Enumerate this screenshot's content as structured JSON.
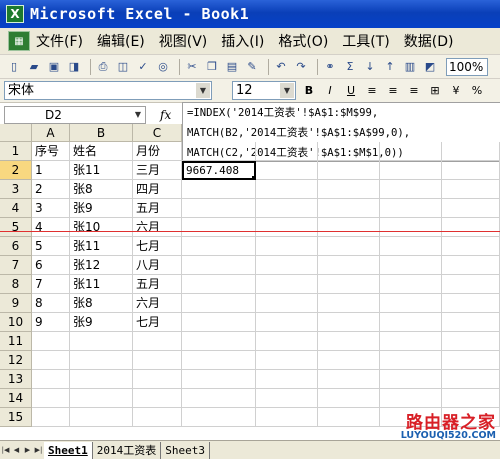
{
  "window": {
    "title": "Microsoft Excel - Book1"
  },
  "menu": {
    "items": [
      "文件(F)",
      "编辑(E)",
      "视图(V)",
      "插入(I)",
      "格式(O)",
      "工具(T)",
      "数据(D)"
    ]
  },
  "toolbar": {
    "zoom": "100%"
  },
  "format_toolbar": {
    "font_name": "宋体",
    "font_size": "12"
  },
  "formula_bar": {
    "name_box": "D2",
    "fx": "fx",
    "formula_lines": [
      "=INDEX('2014工资表'!$A$1:$M$99,",
      "MATCH(B2,'2014工资表'!$A$1:$A$99,0),",
      "MATCH(C2,'2014工资表'!$A$1:$M$1,0))"
    ]
  },
  "grid": {
    "columns": [
      "A",
      "B",
      "C"
    ],
    "rows": [
      {
        "n": "1",
        "a": "序号",
        "b": "姓名",
        "c": "月份",
        "d": ""
      },
      {
        "n": "2",
        "a": "1",
        "b": "张11",
        "c": "三月",
        "d": "9667.408"
      },
      {
        "n": "3",
        "a": "2",
        "b": "张8",
        "c": "四月",
        "d": ""
      },
      {
        "n": "4",
        "a": "3",
        "b": "张9",
        "c": "五月",
        "d": ""
      },
      {
        "n": "5",
        "a": "4",
        "b": "张10",
        "c": "六月",
        "d": ""
      },
      {
        "n": "6",
        "a": "5",
        "b": "张11",
        "c": "七月",
        "d": ""
      },
      {
        "n": "7",
        "a": "6",
        "b": "张12",
        "c": "八月",
        "d": ""
      },
      {
        "n": "8",
        "a": "7",
        "b": "张11",
        "c": "五月",
        "d": ""
      },
      {
        "n": "9",
        "a": "8",
        "b": "张8",
        "c": "六月",
        "d": ""
      },
      {
        "n": "10",
        "a": "9",
        "b": "张9",
        "c": "七月",
        "d": ""
      },
      {
        "n": "11",
        "a": "",
        "b": "",
        "c": "",
        "d": ""
      },
      {
        "n": "12",
        "a": "",
        "b": "",
        "c": "",
        "d": ""
      },
      {
        "n": "13",
        "a": "",
        "b": "",
        "c": "",
        "d": ""
      },
      {
        "n": "14",
        "a": "",
        "b": "",
        "c": "",
        "d": ""
      },
      {
        "n": "15",
        "a": "",
        "b": "",
        "c": "",
        "d": ""
      }
    ]
  },
  "sheet_tabs": [
    "Sheet1",
    "2014工资表",
    "Sheet3"
  ],
  "watermark": {
    "title": "路由器之家",
    "url": "LUYOUQI520.COM"
  },
  "colors": {
    "title_bar": "#0a3fb8",
    "chrome": "#ece9d8",
    "active_header": "#f8d880",
    "red_line": "#e03030"
  }
}
